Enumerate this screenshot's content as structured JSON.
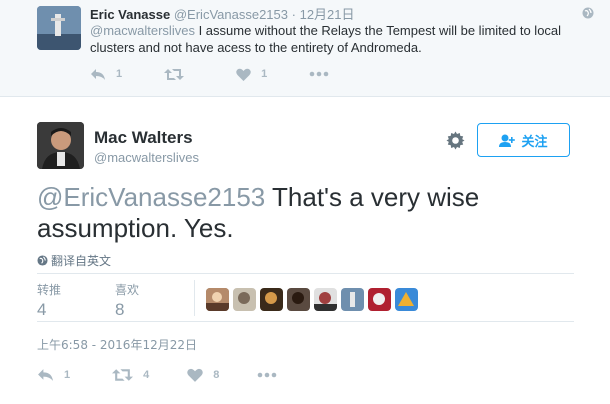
{
  "reply": {
    "name": "Eric Vanasse",
    "handle": "@EricVanasse2153",
    "dot": "·",
    "time": "12月21日",
    "mention": "@macwalterslives",
    "text": " I assume without the Relays the Tempest will be limited to local clusters and not have acess to the entirety of Andromeda.",
    "reply_count": "1",
    "retweet_count": "",
    "like_count": "1"
  },
  "tweet": {
    "name": "Mac Walters",
    "handle": "@macwalterslives",
    "follow_label": "关注",
    "mention": "@EricVanasse2153",
    "text": " That's a very wise assumption. Yes.",
    "translate_label": "翻译自英文",
    "stats": {
      "retweets_label": "转推",
      "retweets": "4",
      "likes_label": "喜欢",
      "likes": "8"
    },
    "timestamp": "上午6:58 - 2016年12月22日",
    "reply_count": "1",
    "retweet_count": "4",
    "like_count": "8"
  },
  "colors": {
    "accent": "#1da1f2",
    "muted": "#8899a6",
    "icon": "#aab8c2"
  },
  "icons": [
    "globe-icon",
    "reply-icon",
    "retweet-icon",
    "heart-icon",
    "more-icon",
    "gear-icon",
    "follow-person-icon"
  ]
}
